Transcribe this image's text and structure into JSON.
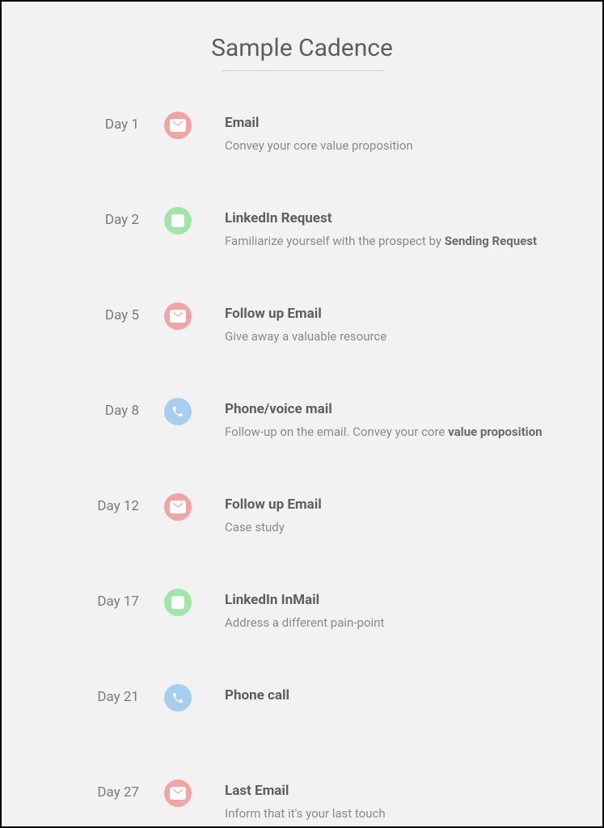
{
  "title": "Sample Cadence",
  "colors": {
    "red": "#f2a3a3",
    "green": "#a0e6a8",
    "blue": "#a7cef0"
  },
  "steps": [
    {
      "day": "Day 1",
      "heading": "Email",
      "desc": "Convey your core value proposition",
      "color": "red",
      "icon": "email"
    },
    {
      "day": "Day 2",
      "heading": "LinkedIn Request",
      "desc_pre": "Familiarize yourself with the prospect by ",
      "desc_strong": "Sending Request",
      "color": "green",
      "icon": "linkedin"
    },
    {
      "day": "Day 5",
      "heading": "Follow up Email",
      "desc": "Give away a valuable resource",
      "color": "red",
      "icon": "email"
    },
    {
      "day": "Day 8",
      "heading": "Phone/voice mail",
      "desc_pre": "Follow-up on the email. Convey your core ",
      "desc_strong": "value proposition",
      "color": "blue",
      "icon": "phone"
    },
    {
      "day": "Day 12",
      "heading": "Follow up Email",
      "desc": "Case study",
      "color": "red",
      "icon": "email"
    },
    {
      "day": "Day 17",
      "heading": "LinkedIn InMail",
      "desc": "Address a different pain-point",
      "color": "green",
      "icon": "linkedin"
    },
    {
      "day": "Day 21",
      "heading": "Phone call",
      "desc": "",
      "color": "blue",
      "icon": "phone"
    },
    {
      "day": "Day 27",
      "heading": "Last Email",
      "desc": "Inform that it's your last touch",
      "color": "red",
      "icon": "email"
    }
  ]
}
